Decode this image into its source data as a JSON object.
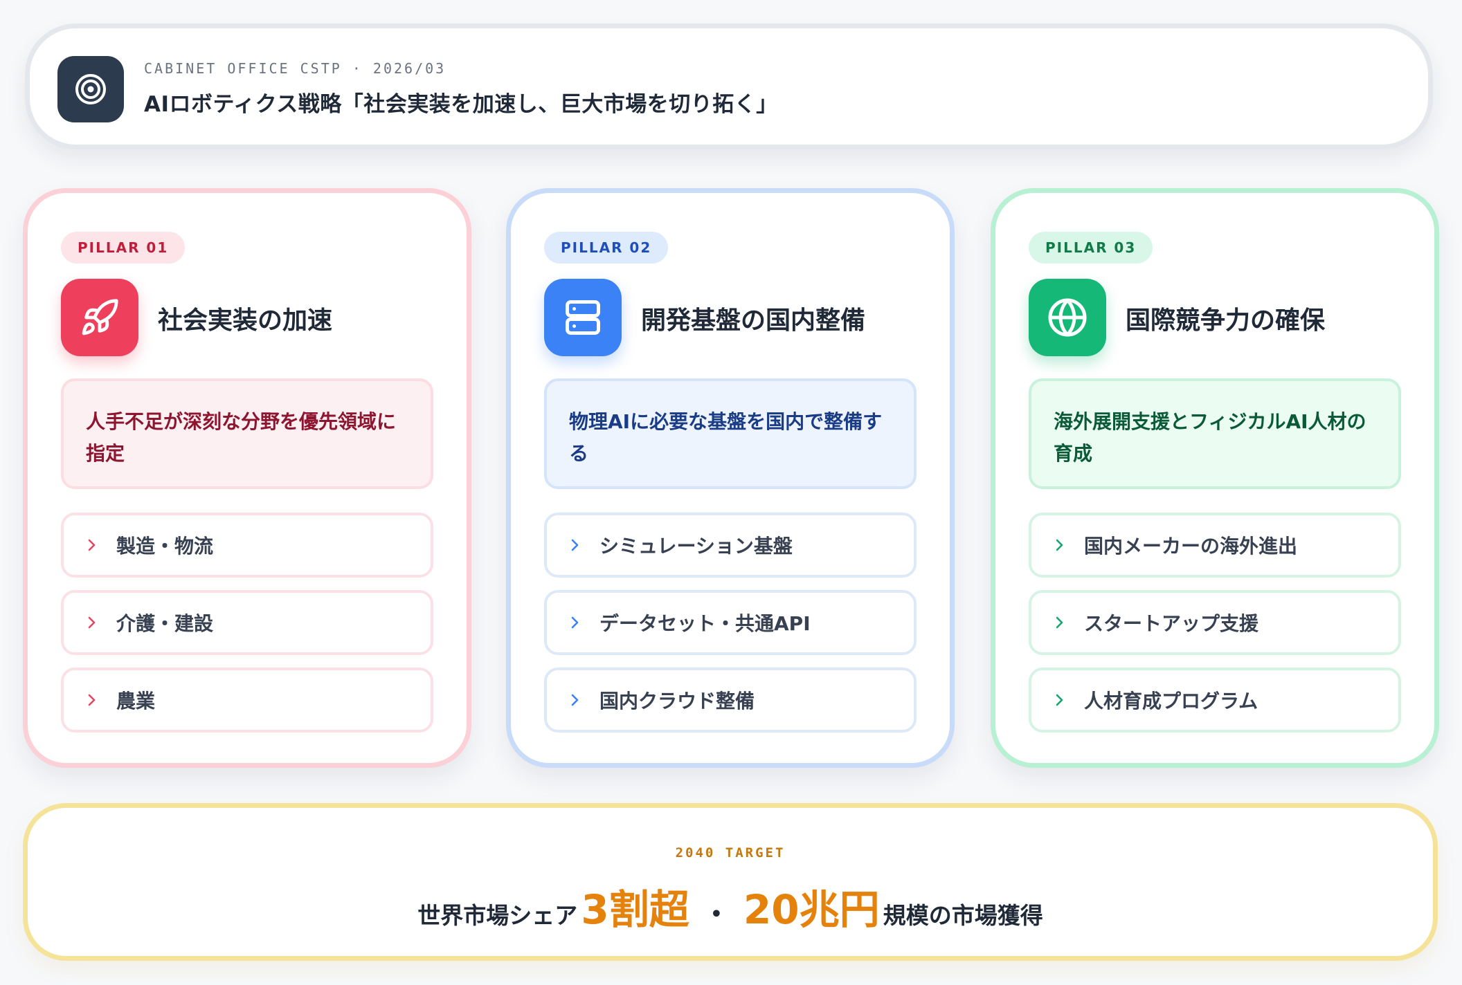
{
  "header": {
    "meta": "CABINET OFFICE CSTP · 2026/03",
    "title": "AIロボティクス戦略「社会実装を加速し、巨大市場を切り拓く」",
    "icon": "target-icon"
  },
  "colors": {
    "pillar_1_accent": "#ee3f5d",
    "pillar_2_accent": "#3b82f6",
    "pillar_3_accent": "#16b877",
    "target_accent": "#e4820c"
  },
  "pillars": [
    {
      "tag": "PILLAR 01",
      "icon": "rocket-icon",
      "title": "社会実装の加速",
      "callout": "人手不足が深刻な分野を優先領域に指定",
      "items": [
        "製造・物流",
        "介護・建設",
        "農業"
      ]
    },
    {
      "tag": "PILLAR 02",
      "icon": "server-icon",
      "title": "開発基盤の国内整備",
      "callout": "物理AIに必要な基盤を国内で整備する",
      "items": [
        "シミュレーション基盤",
        "データセット・共通API",
        "国内クラウド整備"
      ]
    },
    {
      "tag": "PILLAR 03",
      "icon": "globe-icon",
      "title": "国際競争力の確保",
      "callout": "海外展開支援とフィジカルAI人材の育成",
      "items": [
        "国内メーカーの海外進出",
        "スタートアップ支援",
        "人材育成プログラム"
      ]
    }
  ],
  "target": {
    "label": "2040 TARGET",
    "prefix": "世界市場シェア",
    "value_1": "3割超",
    "separator": "・",
    "value_2": "20兆円",
    "suffix": "規模の市場獲得"
  }
}
